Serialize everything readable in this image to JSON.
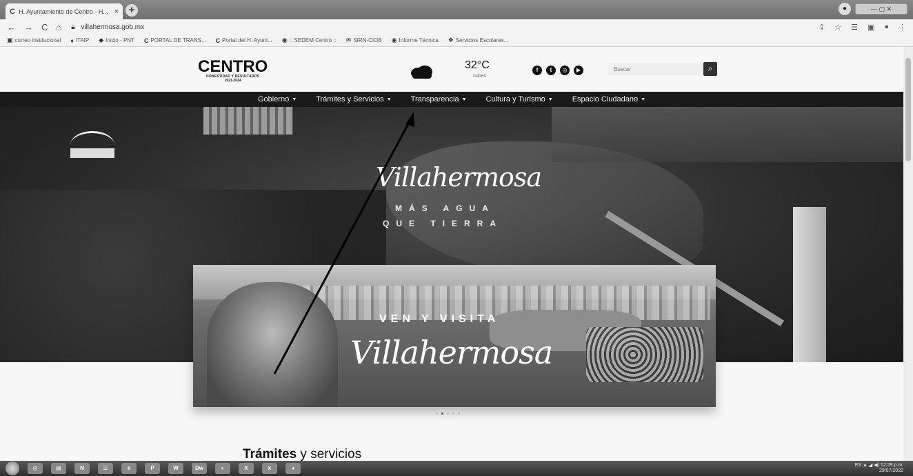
{
  "browser": {
    "tab_title": "H. Ayuntamiento de Centro - H...",
    "tab_close": "×",
    "new_tab": "+",
    "url": "villahermosa.gob.mx",
    "bookmarks": [
      {
        "icon": "▣",
        "label": "correo institucional"
      },
      {
        "icon": "♦",
        "label": "ITAIP"
      },
      {
        "icon": "◆",
        "label": "Inicio - PNT"
      },
      {
        "icon": "C",
        "label": "PORTAL DE TRANS..."
      },
      {
        "icon": "C",
        "label": "Portal del H. Ayunt..."
      },
      {
        "icon": "◉",
        "label": ":: SEDEM Centro ::"
      },
      {
        "icon": "✉",
        "label": "SIRN-CIOB"
      },
      {
        "icon": "◉",
        "label": "Informe Técnica"
      },
      {
        "icon": "❖",
        "label": "Servicios Escolares..."
      }
    ]
  },
  "header": {
    "logo_name": "CENTRO",
    "logo_tagline": "HONESTIDAD Y RESULTADOS",
    "logo_years": "2021-2024",
    "weather_temp": "32°C",
    "weather_desc": "nubes",
    "social": [
      "f",
      "t",
      "◎",
      "▶"
    ],
    "search_placeholder": "Buscar",
    "search_icon": "⌕"
  },
  "nav": [
    {
      "label": "Gobierno"
    },
    {
      "label": "Trámites y Servicios"
    },
    {
      "label": "Transparencia"
    },
    {
      "label": "Cultura y Turismo"
    },
    {
      "label": "Espacio Ciudadano"
    }
  ],
  "hero": {
    "script": "Villahermosa",
    "line1": "MÁS AGUA",
    "line2": "QUE TIERRA"
  },
  "banner": {
    "top": "VEN Y VISITA",
    "script": "Villahermosa",
    "slides": 5,
    "active_slide": 2
  },
  "section": {
    "title_bold": "Trámites",
    "title_rest": " y servicios"
  },
  "taskbar": {
    "apps": [
      "◎",
      "▤",
      "N",
      "☰",
      "e",
      "P",
      "W",
      "Dw",
      "◐",
      "X",
      "x",
      "◕"
    ],
    "lang": "ES",
    "time": "12:29 p.m.",
    "date": "29/07/2022"
  },
  "colors": {
    "nav_bg": "#1a1a1a",
    "arrow": "#000000"
  }
}
